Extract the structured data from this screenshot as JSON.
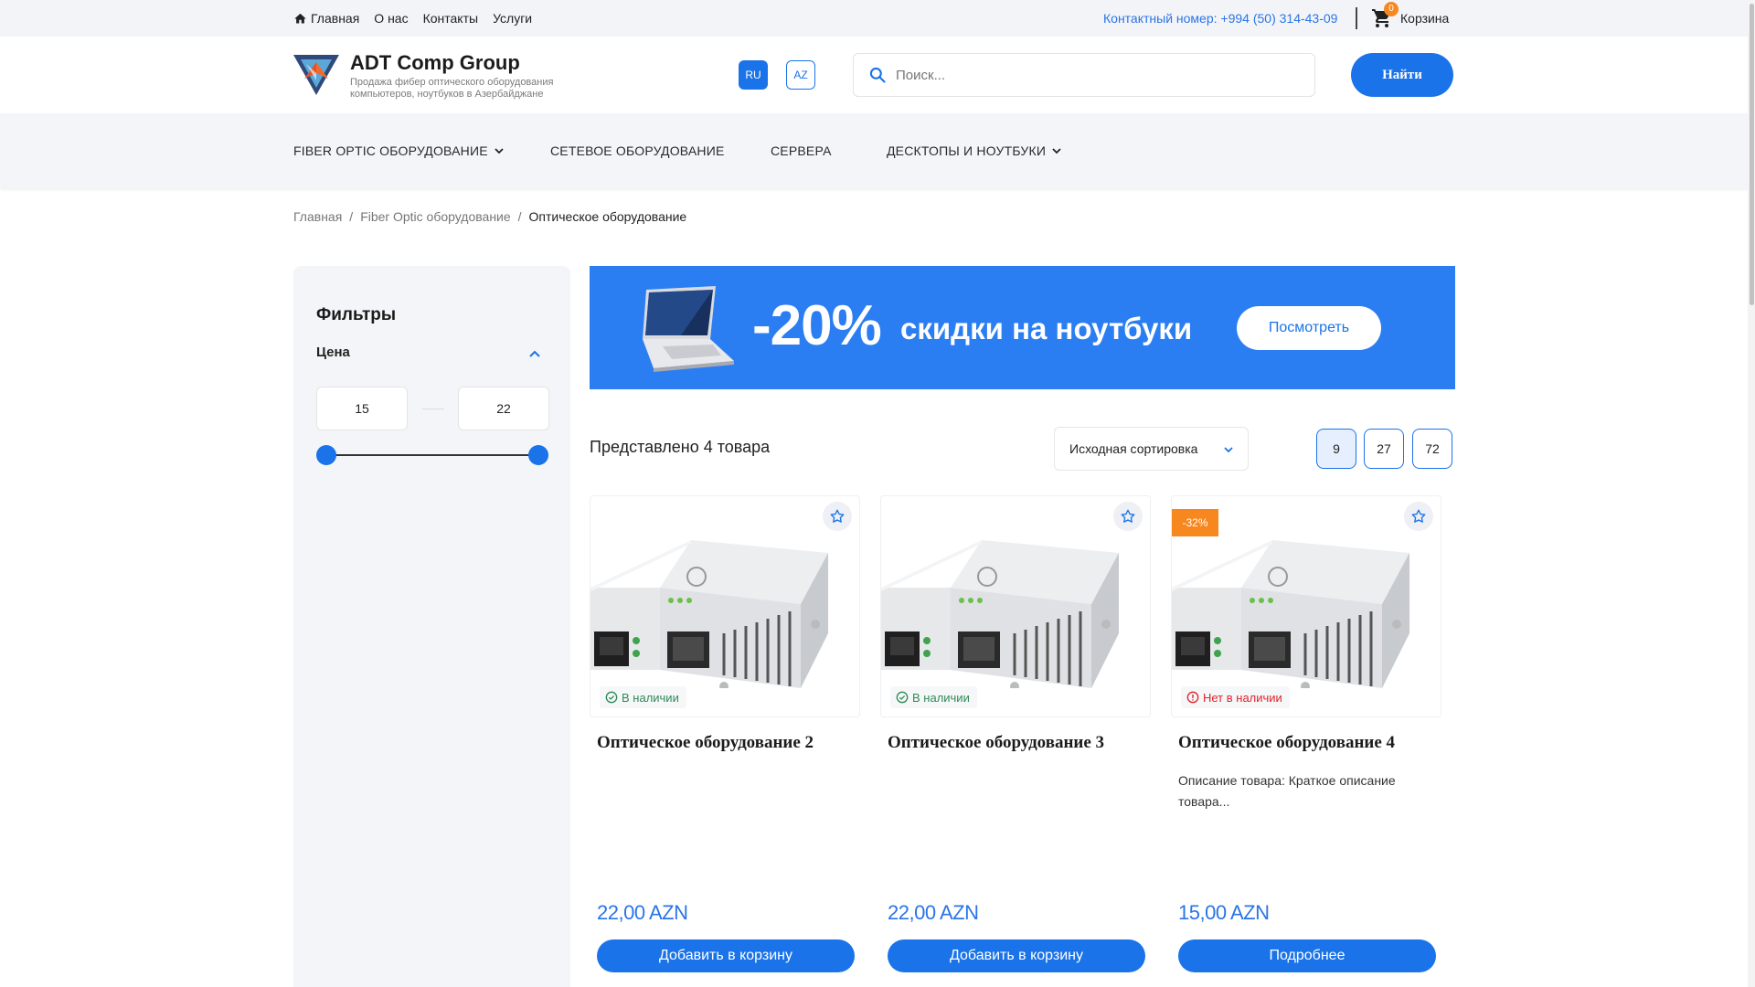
{
  "topbar": {
    "nav": [
      {
        "label": "Главная",
        "icon": "home-icon"
      },
      {
        "label": "О нас"
      },
      {
        "label": "Контакты"
      },
      {
        "label": "Услуги"
      }
    ],
    "contact": "Контактный номер: +994 (50) 314-43-09",
    "cart": {
      "label": "Корзина",
      "count": "0",
      "icon": "cart-icon"
    }
  },
  "header": {
    "brand_name": "ADT Comp Group",
    "brand_tagline": "Продажа фибер оптического оборудования компьютеров, ноутбуков в Азербайджане",
    "languages": [
      {
        "code": "RU",
        "active": true
      },
      {
        "code": "AZ",
        "active": false
      }
    ],
    "search": {
      "placeholder": "Поиск...",
      "value": "",
      "button": "Найти",
      "icon": "search-icon"
    }
  },
  "categories": [
    {
      "label": "FIBER OPTIC ОБОРУДОВАНИЕ",
      "has_dropdown": true
    },
    {
      "label": "СЕТЕВОЕ ОБОРУДОВАНИЕ",
      "has_dropdown": false
    },
    {
      "label": "СЕРВЕРА",
      "has_dropdown": false
    },
    {
      "label": "ДЕСКТОПЫ И НОУТБУКИ",
      "has_dropdown": true
    }
  ],
  "breadcrumb": {
    "items": [
      "Главная",
      "Fiber Optic оборудование"
    ],
    "current": "Оптическое оборудование",
    "separator": "/"
  },
  "filters": {
    "title": "Фильтры",
    "price": {
      "label": "Цена",
      "min": "15",
      "max": "22",
      "expanded": true
    }
  },
  "banner": {
    "percent": "-20%",
    "text": "скидки на ноутбуки",
    "button": "Посмотреть",
    "bg_color": "#2b7ef2"
  },
  "listing": {
    "count_text": "Представлено 4 товара",
    "sort": "Исходная сортировка",
    "per_page": [
      {
        "label": "9",
        "active": true
      },
      {
        "label": "27",
        "active": false
      },
      {
        "label": "72",
        "active": false
      }
    ]
  },
  "products": [
    {
      "title": "Оптическое оборудование 2",
      "stock": "В наличии",
      "in_stock": true,
      "discount": "",
      "description": "",
      "price": "22,00 AZN",
      "button": "Добавить в корзину"
    },
    {
      "title": "Оптическое оборудование 3",
      "stock": "В наличии",
      "in_stock": true,
      "discount": "",
      "description": "",
      "price": "22,00 AZN",
      "button": "Добавить в корзину"
    },
    {
      "title": "Оптическое оборудование 4",
      "stock": "Нет в наличии",
      "in_stock": false,
      "discount": "-32%",
      "description": "Описание товара: Краткое описание товара...",
      "price": "15,00 AZN",
      "button": "Подробнее"
    }
  ],
  "colors": {
    "accent": "#1a73e8",
    "badge": "#f7871f",
    "in_stock": "#2e8b57",
    "out_of_stock": "#e0242b"
  }
}
